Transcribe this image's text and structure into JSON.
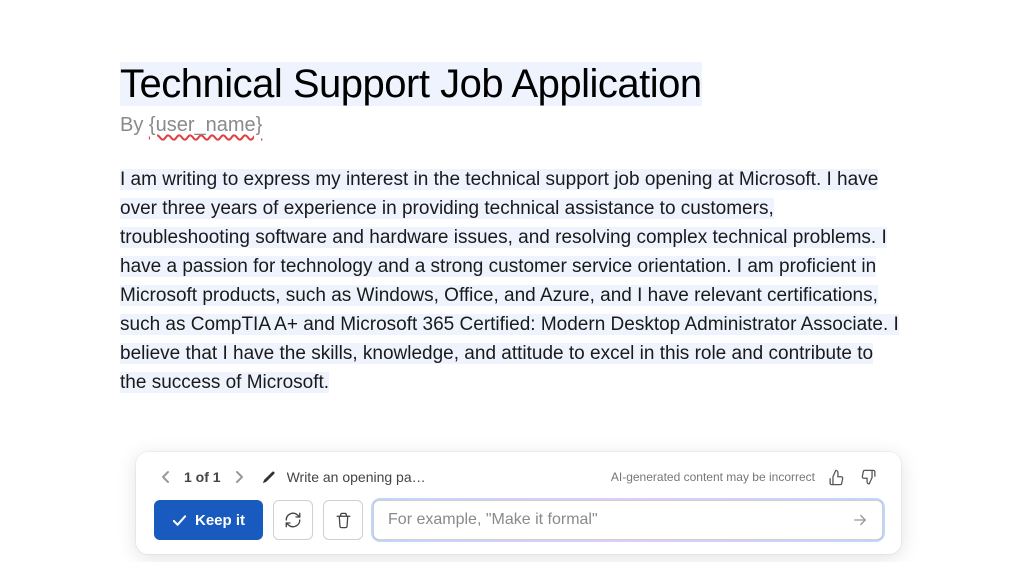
{
  "document": {
    "title": "Technical Support Job Application",
    "byline_prefix": "By ",
    "byline_variable": "{user_name}",
    "body": "I am writing to express my interest in the technical support job opening at Microsoft. I have over three years of experience in providing technical assistance to customers, troubleshooting software and hardware issues, and resolving complex technical problems. I have a passion for technology and a strong customer service orientation. I am proficient in Microsoft products, such as Windows, Office, and Azure, and I have relevant certifications, such as CompTIA A+ and Microsoft 365 Certified: Modern Desktop Administrator Associate. I believe that I have the skills, knowledge, and attitude to excel in this role and contribute to the success of Microsoft."
  },
  "ai_bar": {
    "page_indicator": "1 of 1",
    "prompt_label": "Write an opening pa…",
    "disclaimer": "AI-generated content may be incorrect",
    "keep_label": "Keep it",
    "input_placeholder": "For example, \"Make it formal\"",
    "input_value": ""
  }
}
